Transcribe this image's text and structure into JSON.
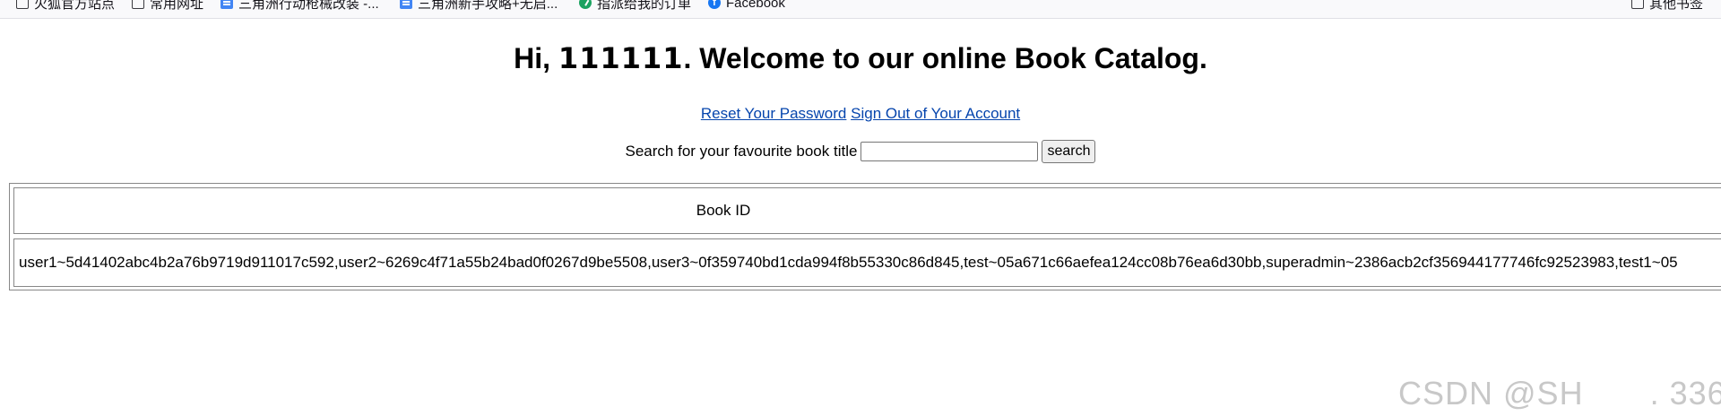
{
  "bookmarks": [
    {
      "label": "火狐官方站点",
      "icon": "folder-icon"
    },
    {
      "label": "常用网址",
      "icon": "folder-icon"
    },
    {
      "label": "三角洲行动枪械改装 -...",
      "icon": "document-icon"
    },
    {
      "label": "三角洲新手攻略+无启...",
      "icon": "document-icon"
    },
    {
      "label": "指派给我的订单",
      "icon": "check-circle-icon"
    },
    {
      "label": "Facebook",
      "icon": "facebook-icon"
    },
    {
      "label": "其他书签",
      "icon": "folder-icon"
    }
  ],
  "header": {
    "greeting_prefix": "Hi, ",
    "username": "111111",
    "greeting_suffix": ". Welcome to our online Book Catalog."
  },
  "links": {
    "reset_password": "Reset Your Password",
    "sign_out": "Sign Out of Your Account"
  },
  "search": {
    "label": "Search for your favourite book title",
    "value": "",
    "button_label": "search"
  },
  "table": {
    "header": "Book ID",
    "row_value": "user1~5d41402abc4b2a76b9719d911017c592,user2~6269c4f71a55b24bad0f0267d9be5508,user3~0f359740bd1cda994f8b55330c86d845,test~05a671c66aefea124cc08b76ea6d30bb,superadmin~2386acb2cf356944177746fc92523983,test1~05"
  },
  "watermark": "CSDN @SH　　. 336"
}
